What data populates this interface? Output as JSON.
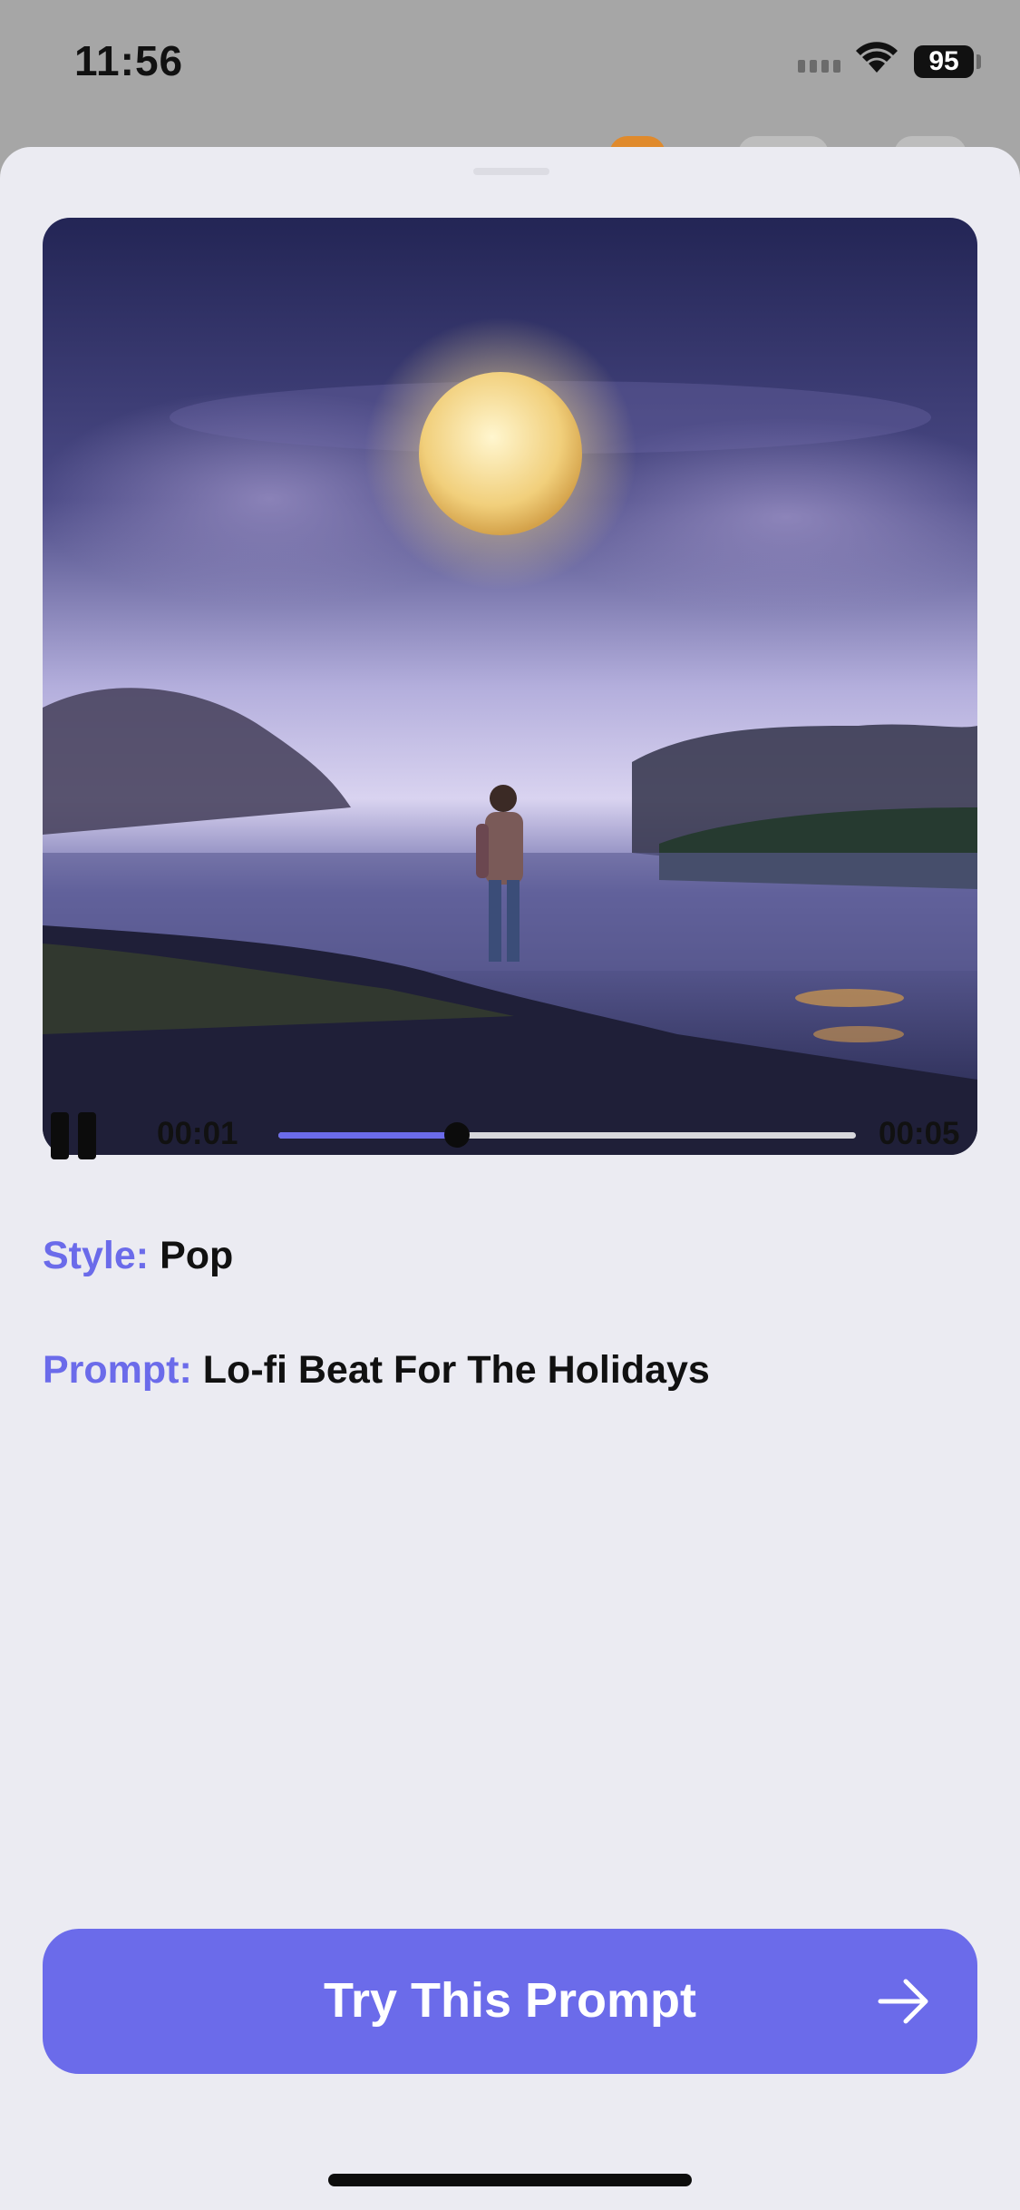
{
  "status_bar": {
    "time": "11:56",
    "battery": "95"
  },
  "cover": {
    "description_icon": "cover-art-image"
  },
  "player": {
    "state": "playing",
    "current_time": "00:01",
    "total_time": "00:05",
    "progress": 0.31
  },
  "details": {
    "style_label": "Style:",
    "style_value": "Pop",
    "prompt_label": "Prompt:",
    "prompt_value": "Lo-fi Beat For The Holidays"
  },
  "cta": {
    "label": "Try This Prompt",
    "icon": "arrow-right-icon"
  },
  "colors": {
    "accent": "#6b6bea",
    "sheet": "#ebebf2",
    "dim_background": "#a6a6a6"
  }
}
